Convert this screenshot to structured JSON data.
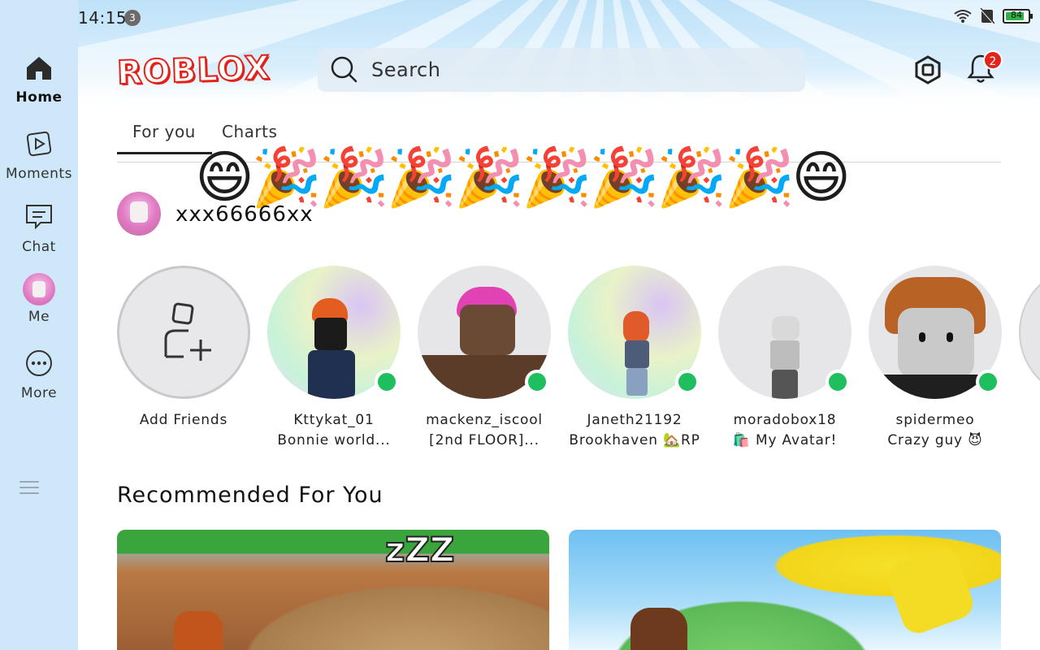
{
  "status_bar": {
    "time": "14:15",
    "notification_count": "3",
    "battery": "84"
  },
  "sidebar": {
    "items": [
      {
        "label": "Home",
        "icon": "home-icon",
        "active": true
      },
      {
        "label": "Moments",
        "icon": "play-icon"
      },
      {
        "label": "Chat",
        "icon": "chat-icon"
      },
      {
        "label": "Me",
        "icon": "avatar"
      },
      {
        "label": "More",
        "icon": "more-icon"
      }
    ]
  },
  "header": {
    "logo": "ROBLOX",
    "search_placeholder": "Search",
    "notifications_badge": "2"
  },
  "tabs": [
    {
      "label": "For you",
      "active": true
    },
    {
      "label": "Charts"
    }
  ],
  "celebration": "😄🎉🎉🎉🎉🎉🎉🎉🎉😄",
  "user": {
    "name": "xxx66666xx"
  },
  "friends": [
    {
      "name": "Add Friends",
      "status": ""
    },
    {
      "name": "Kttykat_01",
      "status": "Bonnie world..."
    },
    {
      "name": "mackenz_iscool",
      "status": "[2nd FLOOR]..."
    },
    {
      "name": "Janeth21192",
      "status": "Brookhaven 🏡RP"
    },
    {
      "name": "moradobox18",
      "status": "🛍️ My Avatar!"
    },
    {
      "name": "spidermeo",
      "status": "Crazy guy 😈"
    }
  ],
  "section": {
    "title": "Recommended For You"
  },
  "colors": {
    "accent": "#e2231a",
    "online": "#1fbf5f",
    "sidebar_bg": "#cfe8f9"
  }
}
